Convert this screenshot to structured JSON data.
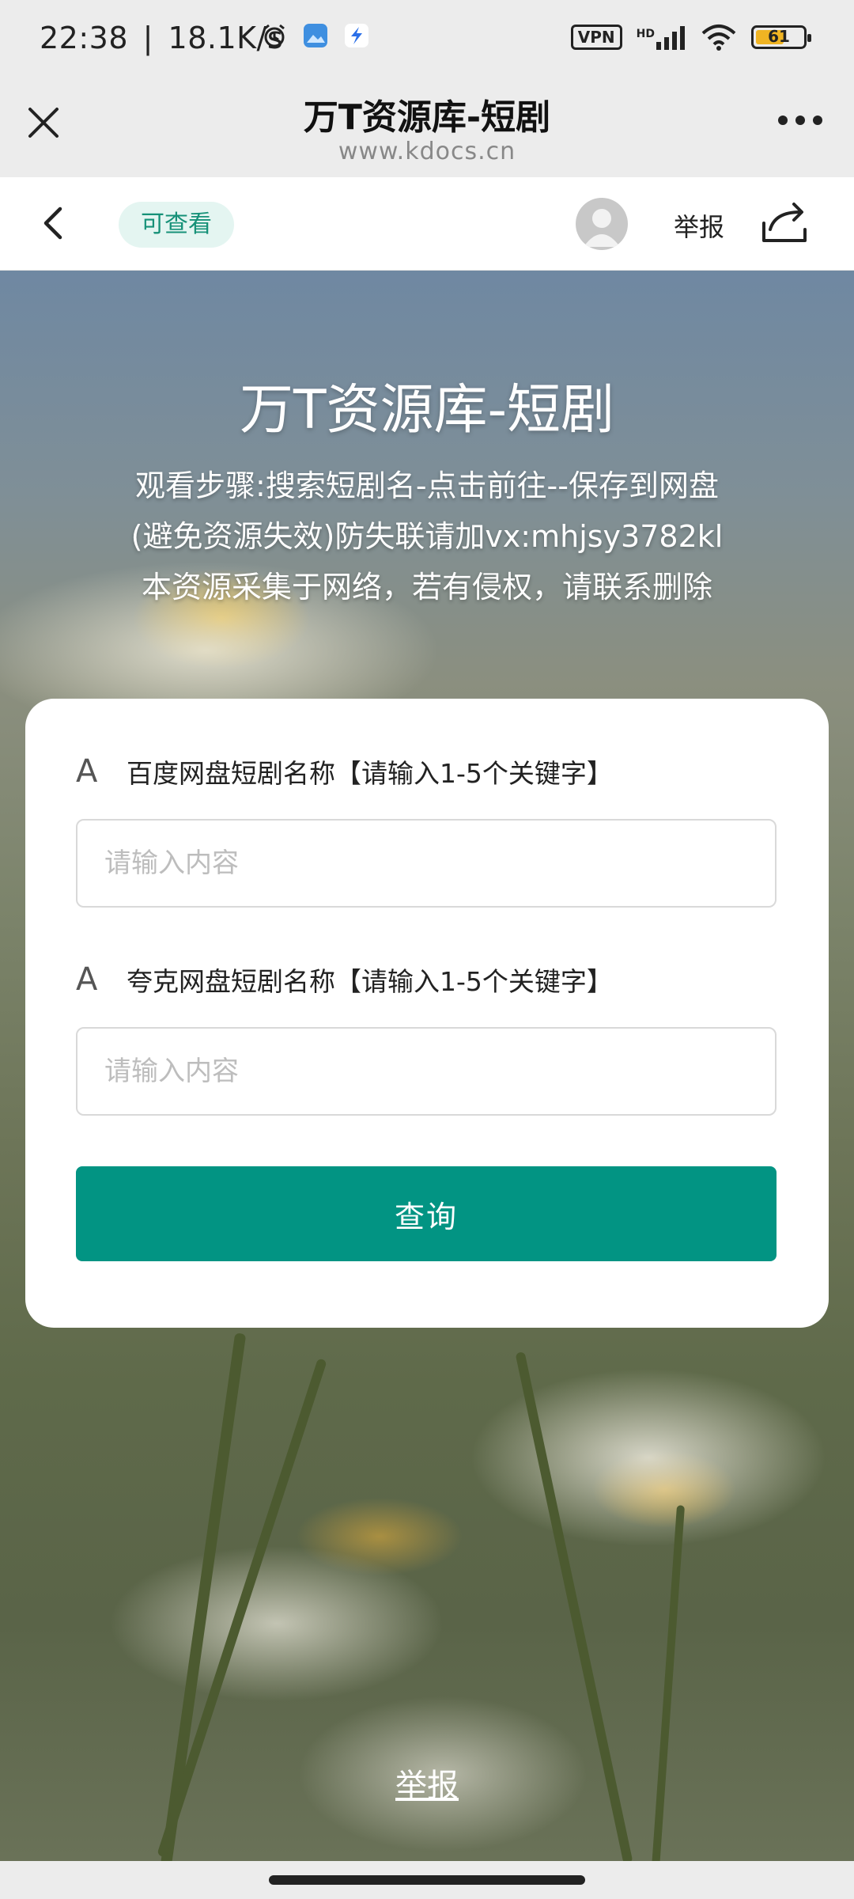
{
  "status_bar": {
    "time": "22:38",
    "speed": "18.1K/s",
    "vpn": "VPN",
    "hd": "HD",
    "battery": "61",
    "battery_level": 0.61,
    "battery_color": "#f0b423"
  },
  "browser": {
    "title": "万T资源库-短剧",
    "url": "www.kdocs.cn"
  },
  "toolbar": {
    "permission": "可查看",
    "report": "举报"
  },
  "hero": {
    "title": "万T资源库-短剧",
    "lines": [
      "观看步骤:搜索短剧名-点击前往--保存到网盘",
      "(避免资源失效)防失联请加vx:mhjsy3782kl",
      "本资源采集于网络，若有侵权，请联系删除"
    ]
  },
  "form": {
    "fields": [
      {
        "label": "百度网盘短剧名称【请输入1-5个关键字】",
        "placeholder": "请输入内容",
        "value": ""
      },
      {
        "label": "夸克网盘短剧名称【请输入1-5个关键字】",
        "placeholder": "请输入内容",
        "value": ""
      }
    ],
    "submit_label": "查询",
    "accent_color": "#029483"
  },
  "footer": {
    "report_link": "举报"
  }
}
